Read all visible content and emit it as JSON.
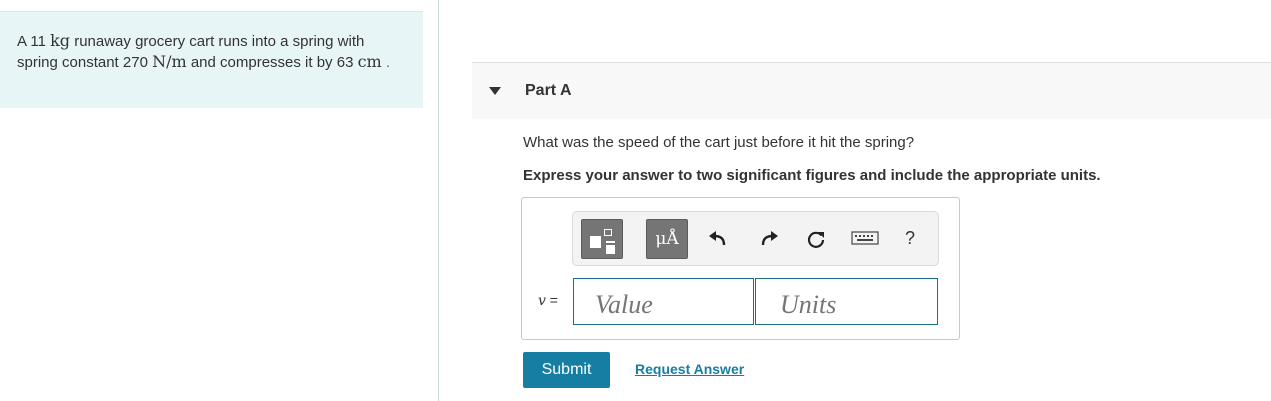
{
  "problem": {
    "p1": "A 11 ",
    "mass_unit": "kg",
    "p2": " runaway grocery cart runs into a spring with spring constant 270 ",
    "k_unit": "N/m",
    "p3": " and compresses it by 63 ",
    "dist_unit": "cm",
    "p4": " ."
  },
  "part": {
    "title": "Part A",
    "caret_icon": "caret-down-icon"
  },
  "question": "What was the speed of the cart just before it hit the spring?",
  "instruction": "Express your answer to two significant figures and include the appropriate units.",
  "toolbar": {
    "units_label": "μÅ",
    "help_label": "?",
    "icons": [
      "templates-icon",
      "units-icon",
      "undo-icon",
      "redo-icon",
      "reset-icon",
      "keyboard-icon",
      "help-icon"
    ]
  },
  "answer": {
    "variable": "v",
    "equals": " =",
    "value_placeholder": "Value",
    "units_placeholder": "Units"
  },
  "actions": {
    "submit_label": "Submit",
    "request_label": "Request Answer"
  },
  "colors": {
    "accent": "#177ea3",
    "problem_bg": "#e8f5f7",
    "toolbar_button": "#757575"
  }
}
